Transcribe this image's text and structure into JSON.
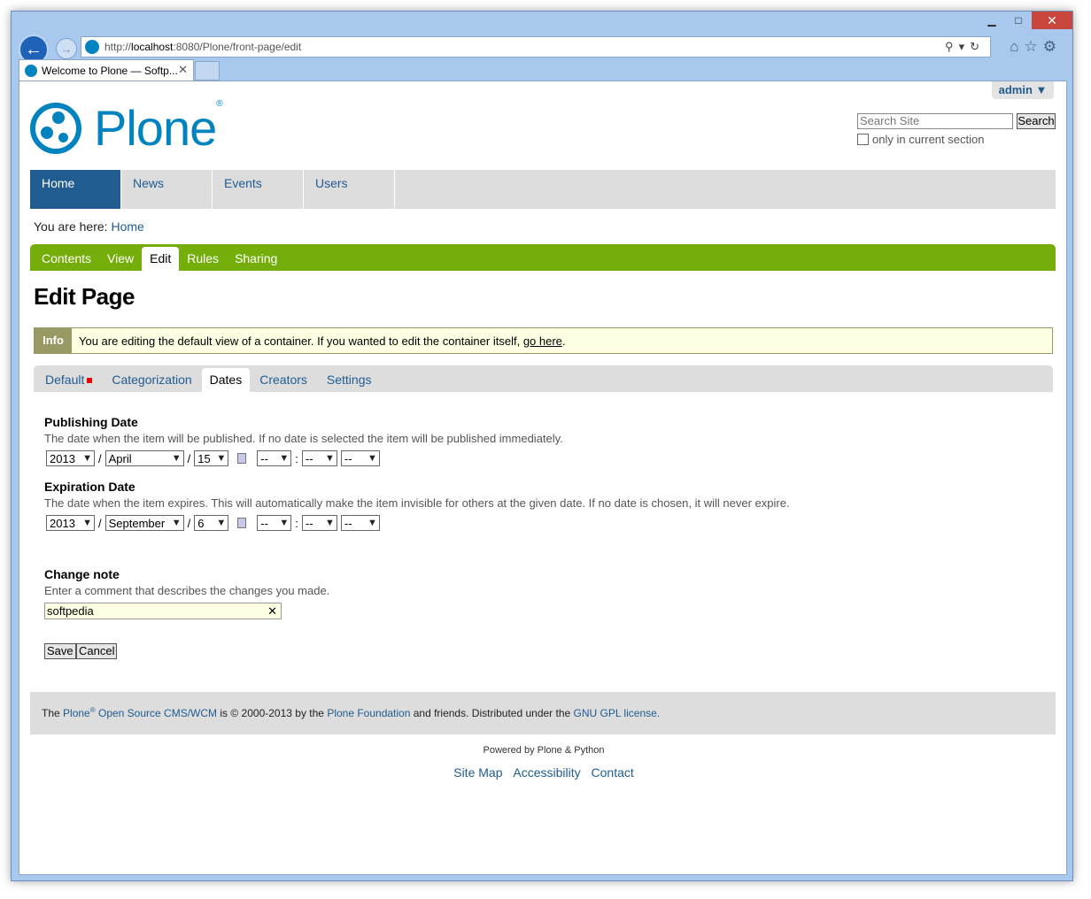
{
  "browser": {
    "url_prefix": "http://",
    "url_host": "localhost",
    "url_rest": ":8080/Plone/front-page/edit",
    "tab_title": "Welcome to Plone — Softp...",
    "window_controls": {
      "minimize": "▁",
      "maximize": "□",
      "close": "✕"
    },
    "addr_tools": "⚲▾↻",
    "icons": [
      "home-icon",
      "star-icon",
      "gear-icon"
    ]
  },
  "header": {
    "user_menu": "admin ▼",
    "logo_text": "Plone",
    "logo_reg": "®",
    "search_placeholder": "Search Site",
    "search_button": "Search",
    "only_section_label": "only in current section"
  },
  "globalnav": [
    {
      "label": "Home"
    },
    {
      "label": "News"
    },
    {
      "label": "Events"
    },
    {
      "label": "Users"
    }
  ],
  "breadcrumb": {
    "prefix": "You are here:",
    "item": "Home"
  },
  "editbar": [
    {
      "label": "Contents"
    },
    {
      "label": "View"
    },
    {
      "label": "Edit"
    },
    {
      "label": "Rules"
    },
    {
      "label": "Sharing"
    }
  ],
  "page_title": "Edit Page",
  "info": {
    "label": "Info",
    "text": "You are editing the default view of a container. If you wanted to edit the container itself,",
    "link": "go here",
    "suffix": "."
  },
  "formtabs": [
    {
      "label": "Default"
    },
    {
      "label": "Categorization"
    },
    {
      "label": "Dates"
    },
    {
      "label": "Creators"
    },
    {
      "label": "Settings"
    }
  ],
  "publishing": {
    "label": "Publishing Date",
    "help": "The date when the item will be published. If no date is selected the item will be published immediately.",
    "year": "2013",
    "month": "April",
    "day": "15",
    "hour": "--",
    "minute": "--",
    "ampm": "--"
  },
  "expiration": {
    "label": "Expiration Date",
    "help": "The date when the item expires. This will automatically make the item invisible for others at the given date. If no date is chosen, it will never expire.",
    "year": "2013",
    "month": "September",
    "day": "6",
    "hour": "--",
    "minute": "--",
    "ampm": "--"
  },
  "separators": {
    "date": "/",
    "time": ":"
  },
  "change_note": {
    "label": "Change note",
    "help": "Enter a comment that describes the changes you made.",
    "value": "softpedia"
  },
  "buttons": {
    "save": "Save",
    "cancel": "Cancel"
  },
  "footer": {
    "the": "The",
    "plone": "Plone",
    "reg": "®",
    "cms": "Open Source CMS/WCM",
    "copyright": "is © 2000-2013 by the",
    "foundation": "Plone Foundation",
    "friends": "and friends. Distributed under the",
    "license": "GNU GPL license",
    "end": "."
  },
  "powered_by": "Powered by Plone & Python",
  "site_actions": [
    {
      "label": "Site Map"
    },
    {
      "label": "Accessibility"
    },
    {
      "label": "Contact"
    }
  ]
}
